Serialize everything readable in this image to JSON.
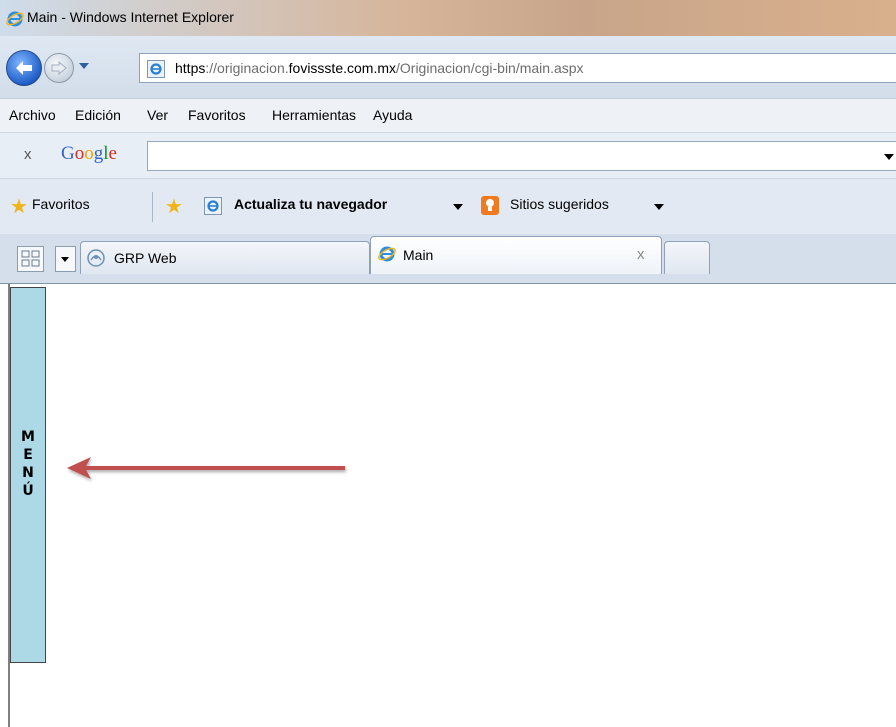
{
  "window": {
    "title": "Main - Windows Internet Explorer"
  },
  "address": {
    "scheme": "https",
    "sep": "://originacion.",
    "domain": "fovissste.com.mx",
    "path": "/Originacion/cgi-bin/main.aspx"
  },
  "menu": [
    "Archivo",
    "Edición",
    "Ver",
    "Favoritos",
    "Herramientas",
    "Ayuda"
  ],
  "google_toolbar": {
    "close": "x",
    "logo": "Google",
    "search_value": ""
  },
  "favorites_bar": {
    "favorites_label": "Favoritos",
    "update_label": "Actualiza tu navegador",
    "suggested_label": "Sitios sugeridos"
  },
  "tabs": [
    {
      "label": "GRP Web",
      "active": false
    },
    {
      "label": "Main",
      "active": true
    }
  ],
  "tab_close": "x",
  "side_menu": {
    "letters": [
      "M",
      "E",
      "N",
      "Ú"
    ]
  },
  "colors": {
    "side_menu_bg": "#add8e6",
    "arrow": "#c0504d"
  }
}
